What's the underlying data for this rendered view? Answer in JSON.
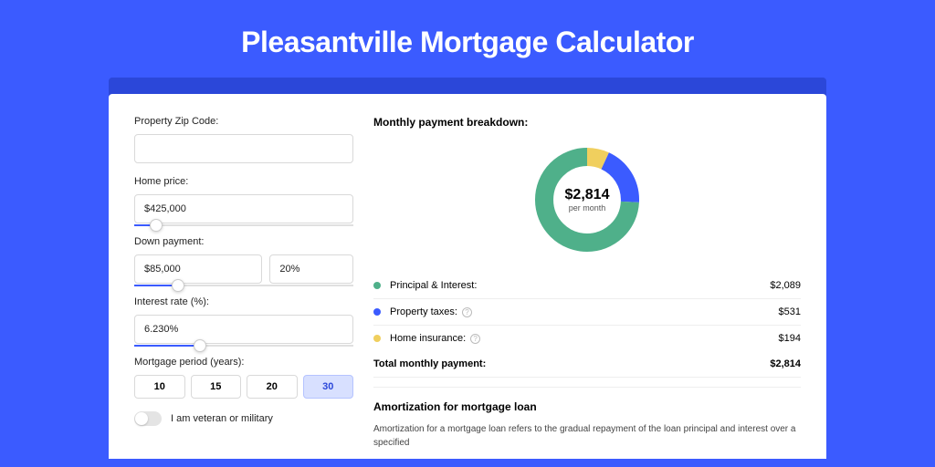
{
  "title": "Pleasantville Mortgage Calculator",
  "form": {
    "zip_label": "Property Zip Code:",
    "zip_value": "",
    "home_price_label": "Home price:",
    "home_price_value": "$425,000",
    "home_price_slider_pct": 10,
    "down_payment_label": "Down payment:",
    "down_payment_value": "$85,000",
    "down_payment_pct": "20%",
    "down_payment_slider_pct": 20,
    "interest_label": "Interest rate (%):",
    "interest_value": "6.230%",
    "interest_slider_pct": 30,
    "period_label": "Mortgage period (years):",
    "periods": [
      "10",
      "15",
      "20",
      "30"
    ],
    "period_active": "30",
    "veteran_label": "I am veteran or military"
  },
  "breakdown": {
    "title": "Monthly payment breakdown:",
    "center_amount": "$2,814",
    "center_sub": "per month",
    "items": [
      {
        "label": "Principal & Interest:",
        "value": "$2,089",
        "color": "#4fb08a",
        "info": false,
        "num": 2089
      },
      {
        "label": "Property taxes:",
        "value": "$531",
        "color": "#3b5bff",
        "info": true,
        "num": 531
      },
      {
        "label": "Home insurance:",
        "value": "$194",
        "color": "#f0cf5e",
        "info": true,
        "num": 194
      }
    ],
    "total_label": "Total monthly payment:",
    "total_value": "$2,814"
  },
  "amort": {
    "title": "Amortization for mortgage loan",
    "text": "Amortization for a mortgage loan refers to the gradual repayment of the loan principal and interest over a specified"
  },
  "chart_data": {
    "type": "pie",
    "title": "Monthly payment breakdown",
    "series": [
      {
        "name": "Principal & Interest",
        "value": 2089,
        "color": "#4fb08a"
      },
      {
        "name": "Property taxes",
        "value": 531,
        "color": "#3b5bff"
      },
      {
        "name": "Home insurance",
        "value": 194,
        "color": "#f0cf5e"
      }
    ],
    "total": 2814,
    "center_label": "$2,814 per month"
  }
}
